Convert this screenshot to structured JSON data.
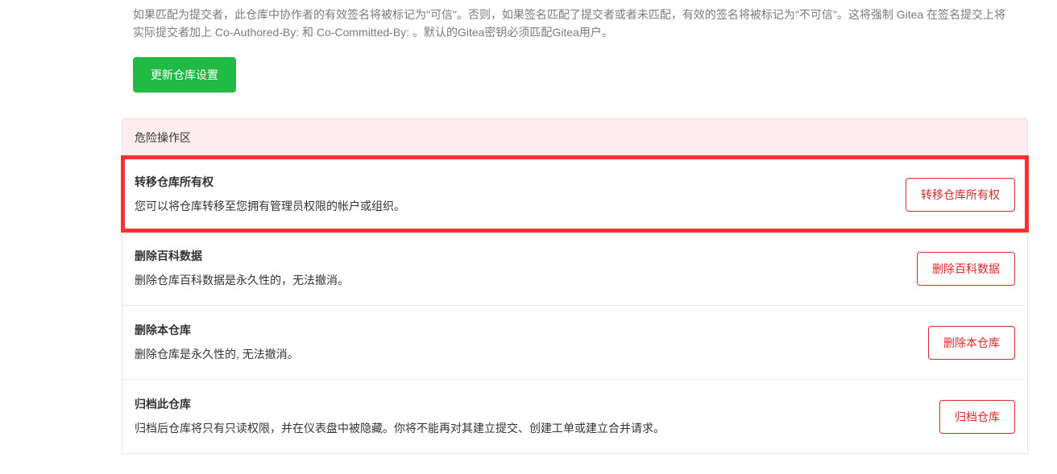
{
  "settings": {
    "signing_description": "如果匹配为提交者，此仓库中协作者的有效签名将被标记为\"可信\"。否则，如果签名匹配了提交者或者未匹配，有效的签名将被标记为\"不可信\"。这将强制 Gitea 在签名提交上将实际提交者加上 Co-Authored-By: 和 Co-Committed-By: 。默认的Gitea密钥必须匹配Gitea用户。",
    "update_button_label": "更新仓库设置"
  },
  "danger_zone": {
    "header": "危险操作区",
    "items": [
      {
        "title": "转移仓库所有权",
        "description": "您可以将仓库转移至您拥有管理员权限的帐户或组织。",
        "button_label": "转移仓库所有权"
      },
      {
        "title": "删除百科数据",
        "description": "删除仓库百科数据是永久性的，无法撤消。",
        "button_label": "删除百科数据"
      },
      {
        "title": "删除本仓库",
        "description": "删除仓库是永久性的, 无法撤消。",
        "button_label": "删除本仓库"
      },
      {
        "title": "归档此仓库",
        "description": "归档后仓库将只有只读权限，并在仪表盘中被隐藏。你将不能再对其建立提交、创建工单或建立合并请求。",
        "button_label": "归档仓库"
      }
    ]
  }
}
